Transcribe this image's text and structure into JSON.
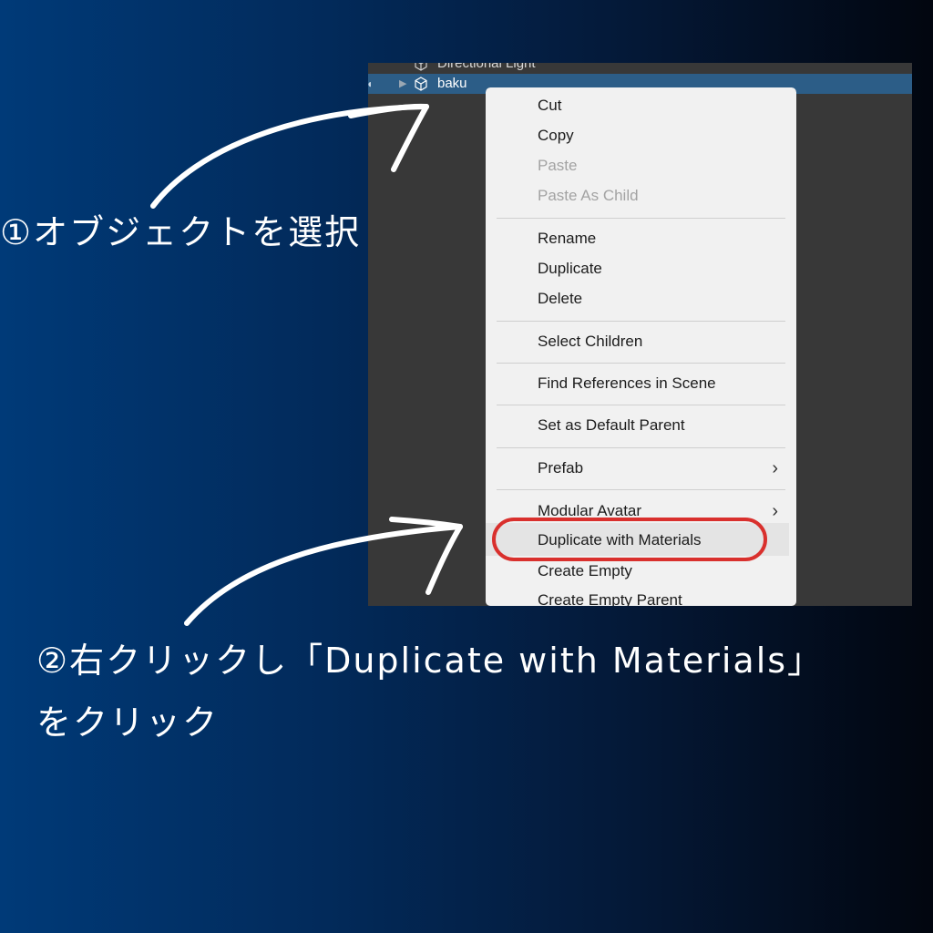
{
  "hierarchy": {
    "partial_row": "Directional Light",
    "selected_row": "baku"
  },
  "context_menu": {
    "items": [
      {
        "label": "Cut",
        "enabled": true
      },
      {
        "label": "Copy",
        "enabled": true
      },
      {
        "label": "Paste",
        "enabled": false
      },
      {
        "label": "Paste As Child",
        "enabled": false
      },
      {
        "label": "Rename",
        "enabled": true
      },
      {
        "label": "Duplicate",
        "enabled": true
      },
      {
        "label": "Delete",
        "enabled": true
      },
      {
        "label": "Select Children",
        "enabled": true
      },
      {
        "label": "Find References in Scene",
        "enabled": true
      },
      {
        "label": "Set as Default Parent",
        "enabled": true
      },
      {
        "label": "Prefab",
        "enabled": true,
        "submenu": true
      },
      {
        "label": "Modular Avatar",
        "enabled": true,
        "submenu": true
      },
      {
        "label": "Duplicate with Materials",
        "enabled": true,
        "highlighted": true
      },
      {
        "label": "Create Empty",
        "enabled": true
      },
      {
        "label": "Create Empty Parent",
        "enabled": true
      }
    ]
  },
  "annotations": {
    "step1": "①オブジェクトを選択",
    "step2_line1": "②右クリックし「Duplicate with Materials」",
    "step2_line2": "をクリック"
  },
  "colors": {
    "highlight_ring": "#d9302d",
    "selection": "#2c5d87",
    "menu_background": "#f1f1f1",
    "panel_background": "#383838"
  }
}
